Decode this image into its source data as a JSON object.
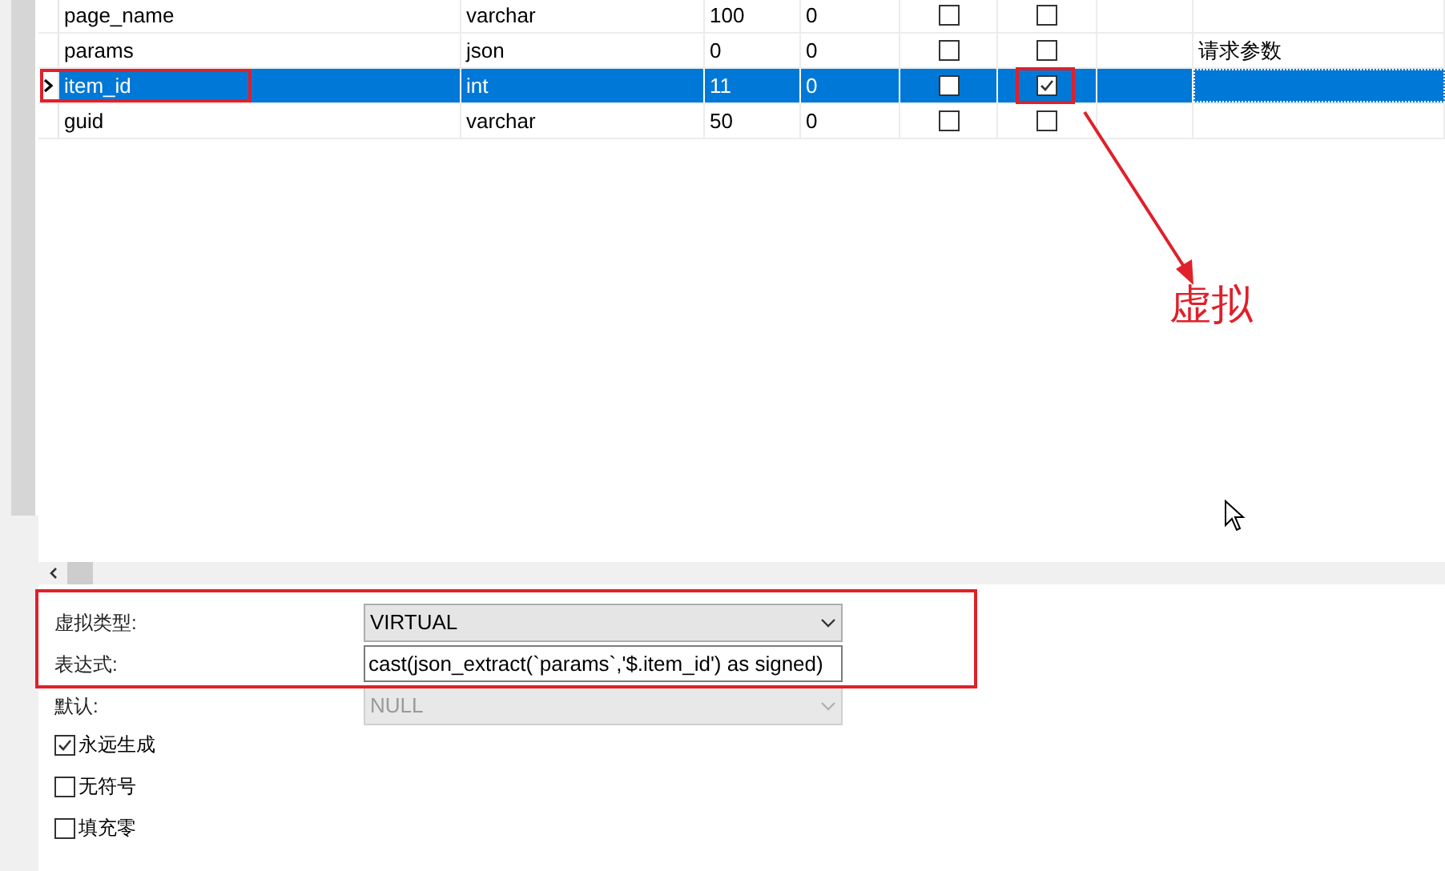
{
  "fields_grid": {
    "rows": [
      {
        "name": "page_name",
        "type": "varchar",
        "length": "100",
        "decimals": "0",
        "not_null": false,
        "virtual": false,
        "comment": "",
        "selected": false
      },
      {
        "name": "params",
        "type": "json",
        "length": "0",
        "decimals": "0",
        "not_null": false,
        "virtual": false,
        "comment": "请求参数",
        "selected": false
      },
      {
        "name": "item_id",
        "type": "int",
        "length": "11",
        "decimals": "0",
        "not_null": false,
        "virtual": true,
        "comment": "",
        "selected": true
      },
      {
        "name": "guid",
        "type": "varchar",
        "length": "50",
        "decimals": "0",
        "not_null": false,
        "virtual": false,
        "comment": "",
        "selected": false
      }
    ]
  },
  "properties": {
    "virtual_type": {
      "label": "虚拟类型:",
      "value": "VIRTUAL",
      "disabled": false
    },
    "expression": {
      "label": "表达式:",
      "value": "cast(json_extract(`params`,'$.item_id') as signed)"
    },
    "default": {
      "label": "默认:",
      "value": "NULL",
      "disabled": true
    },
    "checkboxes": [
      {
        "label": "永远生成",
        "checked": true
      },
      {
        "label": "无符号",
        "checked": false
      },
      {
        "label": "填充零",
        "checked": false
      }
    ]
  },
  "annotation": {
    "text": "虚拟"
  }
}
